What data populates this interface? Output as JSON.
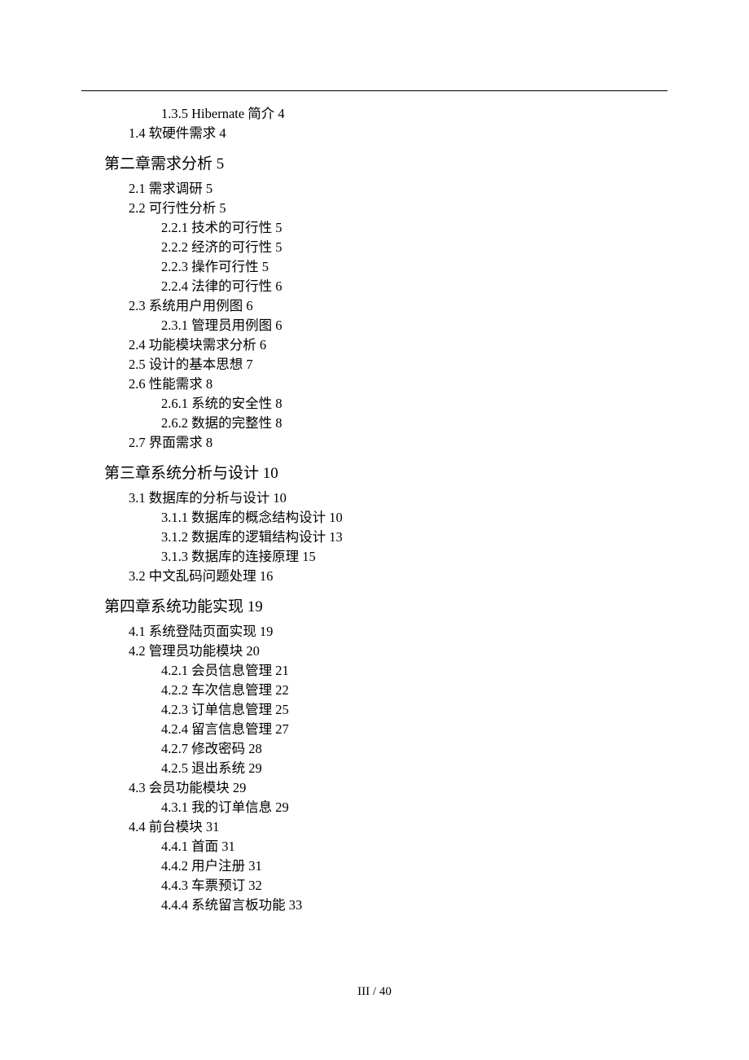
{
  "header": {
    "dots": ".   .        .    ."
  },
  "toc": {
    "items": [
      {
        "level": 2,
        "text": "1.3.5 Hibernate 简介 4"
      },
      {
        "level": 1,
        "text": "1.4 软硬件需求 4"
      },
      {
        "level": 0,
        "text": "第二章需求分析 5"
      },
      {
        "level": 1,
        "text": "2.1 需求调研 5"
      },
      {
        "level": 1,
        "text": "2.2 可行性分析 5"
      },
      {
        "level": 2,
        "text": "2.2.1 技术的可行性 5"
      },
      {
        "level": 2,
        "text": "2.2.2 经济的可行性 5"
      },
      {
        "level": 2,
        "text": "2.2.3 操作可行性 5"
      },
      {
        "level": 2,
        "text": "2.2.4 法律的可行性 6"
      },
      {
        "level": 1,
        "text": "2.3 系统用户用例图 6"
      },
      {
        "level": 2,
        "text": "2.3.1 管理员用例图 6"
      },
      {
        "level": 1,
        "text": "2.4 功能模块需求分析 6"
      },
      {
        "level": 1,
        "text": "2.5 设计的基本思想 7"
      },
      {
        "level": 1,
        "text": "2.6 性能需求 8"
      },
      {
        "level": 2,
        "text": "2.6.1 系统的安全性 8"
      },
      {
        "level": 2,
        "text": "2.6.2 数据的完整性 8"
      },
      {
        "level": 1,
        "text": "2.7 界面需求 8"
      },
      {
        "level": 0,
        "text": "第三章系统分析与设计 10"
      },
      {
        "level": 1,
        "text": "3.1 数据库的分析与设计 10"
      },
      {
        "level": 2,
        "text": "3.1.1 数据库的概念结构设计 10"
      },
      {
        "level": 2,
        "text": "3.1.2 数据库的逻辑结构设计 13"
      },
      {
        "level": 2,
        "text": "3.1.3 数据库的连接原理 15"
      },
      {
        "level": 1,
        "text": "3.2 中文乱码问题处理 16"
      },
      {
        "level": 0,
        "text": "第四章系统功能实现 19"
      },
      {
        "level": 1,
        "text": "4.1 系统登陆页面实现 19"
      },
      {
        "level": 1,
        "text": "4.2 管理员功能模块 20"
      },
      {
        "level": 2,
        "text": "4.2.1 会员信息管理 21"
      },
      {
        "level": 2,
        "text": "4.2.2 车次信息管理 22"
      },
      {
        "level": 2,
        "text": "4.2.3 订单信息管理 25"
      },
      {
        "level": 2,
        "text": "4.2.4 留言信息管理 27"
      },
      {
        "level": 2,
        "text": "4.2.7 修改密码 28"
      },
      {
        "level": 2,
        "text": "4.2.5 退出系统 29"
      },
      {
        "level": 1,
        "text": "4.3 会员功能模块 29"
      },
      {
        "level": 2,
        "text": "4.3.1 我的订单信息 29"
      },
      {
        "level": 1,
        "text": "4.4 前台模块 31"
      },
      {
        "level": 2,
        "text": "4.4.1 首面 31"
      },
      {
        "level": 2,
        "text": "4.4.2 用户注册 31"
      },
      {
        "level": 2,
        "text": "4.4.3 车票预订 32"
      },
      {
        "level": 2,
        "text": "4.4.4 系统留言板功能 33"
      }
    ]
  },
  "footer": {
    "page_number": "III / 40"
  }
}
